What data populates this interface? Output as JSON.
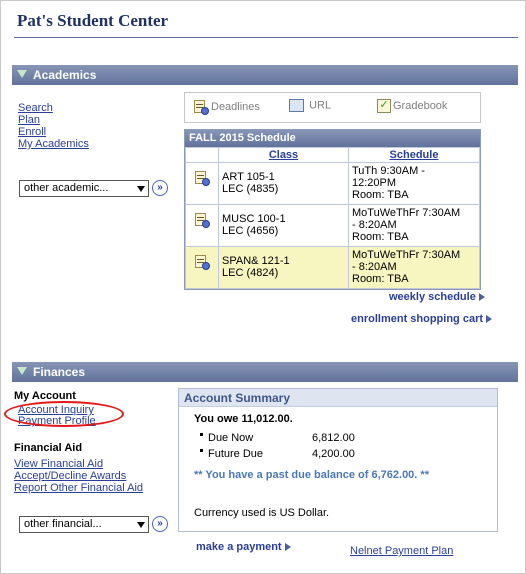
{
  "page": {
    "title": "Pat's Student Center"
  },
  "academics": {
    "section_title": "Academics",
    "links": [
      "Search",
      "Plan",
      "Enroll",
      "My Academics"
    ],
    "dropdown": "other academic...",
    "go": "»",
    "quick": {
      "deadlines": "Deadlines",
      "url": "URL",
      "gradebook": "Gradebook"
    },
    "schedule": {
      "title": "FALL 2015 Schedule",
      "col_class": "Class",
      "col_schedule": "Schedule",
      "rows": [
        {
          "c1": "ART 105-1",
          "c2": "LEC (4835)",
          "s1": "TuTh 9:30AM -",
          "s2": "12:20PM",
          "s3": "Room:  TBA"
        },
        {
          "c1": "MUSC 100-1",
          "c2": "LEC (4656)",
          "s1": "MoTuWeThFr 7:30AM",
          "s2": "- 8:20AM",
          "s3": "Room:  TBA"
        },
        {
          "c1": "SPAN& 121-1",
          "c2": "LEC (4824)",
          "s1": "MoTuWeThFr 7:30AM",
          "s2": "- 8:20AM",
          "s3": "Room:  TBA"
        }
      ]
    },
    "weekly_schedule": "weekly schedule",
    "shopping_cart": "enrollment shopping cart"
  },
  "finances": {
    "section_title": "Finances",
    "my_account": "My Account",
    "account_inquiry": "Account Inquiry",
    "payment_profile": "Payment Profile",
    "financial_aid": "Financial Aid",
    "aid_links": [
      "View Financial Aid",
      "Accept/Decline Awards",
      "Report Other Financial Aid"
    ],
    "dropdown": "other financial...",
    "summary": {
      "title": "Account Summary",
      "owe": "You owe 11,012.00.",
      "due_now_label": "Due Now",
      "due_now": "6,812.00",
      "future_label": "Future Due",
      "future": "4,200.00",
      "past_due": "** You have a past due balance of 6,762.00. **",
      "currency": "Currency used is US Dollar."
    },
    "make_payment": "make a payment",
    "nelnet": "Nelnet Payment Plan"
  }
}
